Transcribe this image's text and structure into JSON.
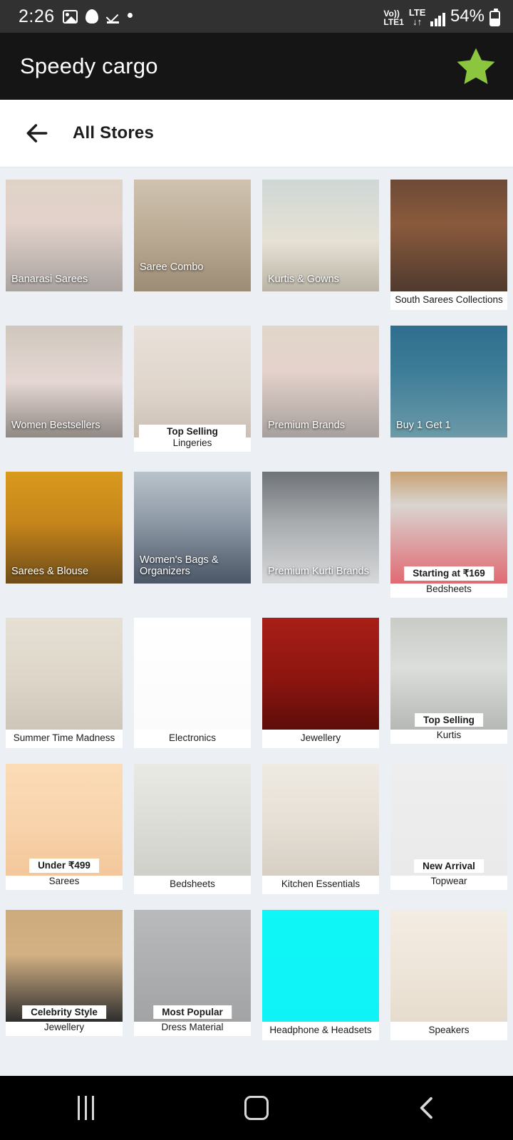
{
  "status_bar": {
    "time": "2:26",
    "left_icons": [
      "photo-icon",
      "snapchat-ghost-icon",
      "tick-underline-icon",
      "dot-icon"
    ],
    "volte_top": "Vo))",
    "volte_bottom": "LTE1",
    "network_type": "LTE",
    "data_arrows": "↓↑",
    "signal_icon": "signal-bars-icon",
    "battery_percent": "54%",
    "battery_icon": "battery-icon"
  },
  "app_bar": {
    "title": "Speedy cargo",
    "action_icon": "star-icon",
    "star_color": "#8CC63E",
    "background": "#151515"
  },
  "sub_header": {
    "back_icon": "arrow-left-icon",
    "title": "All Stores"
  },
  "theme": {
    "page_background": "#eceff3",
    "tile_background": "#ffffff",
    "text_color": "#1b1b1b"
  },
  "stores": [
    {
      "label": "Banarasi Sarees",
      "style": "overlay",
      "line2": "",
      "img": "banarasi-sarees"
    },
    {
      "label": "Saree Combo",
      "style": "overlay-high",
      "line2": "",
      "img": "saree-combo"
    },
    {
      "label": "Kurtis & Gowns",
      "style": "overlay",
      "line2": "",
      "img": "kurtis-gowns"
    },
    {
      "label": "South Sarees Collections",
      "style": "bar",
      "line2": "",
      "img": "south-sarees-collections"
    },
    {
      "label": "Women Bestsellers",
      "style": "overlay",
      "line2": "",
      "img": "women-bestsellers"
    },
    {
      "label": "Top Selling",
      "style": "bar2",
      "line2": "Lingeries",
      "img": "top-selling-lingeries"
    },
    {
      "label": "Premium Brands",
      "style": "overlay",
      "line2": "",
      "img": "premium-brands"
    },
    {
      "label": "Buy 1 Get 1",
      "style": "overlay",
      "line2": "",
      "img": "buy-1-get-1"
    },
    {
      "label": "Sarees & Blouse",
      "style": "overlay",
      "line2": "",
      "img": "sarees-blouse"
    },
    {
      "label": "Women's Bags & Organizers",
      "style": "overlay",
      "line2": "",
      "img": "womens-bags-organizers"
    },
    {
      "label": "Premium Kurti Brands",
      "style": "overlay",
      "line2": "",
      "img": "premium-kurti-brands"
    },
    {
      "label": "Starting at ₹169",
      "style": "float",
      "line2": "Bedsheets",
      "img": "bedsheets-169"
    },
    {
      "label": "Summer Time Madness",
      "style": "bar",
      "line2": "",
      "img": "summer-time-madness"
    },
    {
      "label": "Electronics",
      "style": "bar",
      "line2": "",
      "img": "electronics"
    },
    {
      "label": "Jewellery",
      "style": "bar",
      "line2": "",
      "img": "jewellery-pot"
    },
    {
      "label": "Top Selling",
      "style": "float",
      "line2": "Kurtis",
      "img": "top-selling-kurtis"
    },
    {
      "label": "Under ₹499",
      "style": "float",
      "line2": "Sarees",
      "img": "under-499-sarees"
    },
    {
      "label": "Bedsheets",
      "style": "bar",
      "line2": "",
      "img": "bedsheets"
    },
    {
      "label": "Kitchen Essentials",
      "style": "bar",
      "line2": "",
      "img": "kitchen-essentials"
    },
    {
      "label": "New Arrival",
      "style": "float",
      "line2": "Topwear",
      "img": "new-arrival-topwear"
    },
    {
      "label": "Celebrity Style",
      "style": "float",
      "line2": "Jewellery",
      "img": "celebrity-style-jewellery"
    },
    {
      "label": "Most Popular",
      "style": "float",
      "line2": "Dress Material",
      "img": "most-popular-dress-material"
    },
    {
      "label": "Headphone & Headsets",
      "style": "bar",
      "line2": "",
      "img": "headphone-headsets"
    },
    {
      "label": "Speakers",
      "style": "bar",
      "line2": "",
      "img": "speakers"
    }
  ],
  "nav_bar": {
    "recents_icon": "recents-icon",
    "home_icon": "home-icon",
    "back_icon": "back-chevron-icon"
  }
}
